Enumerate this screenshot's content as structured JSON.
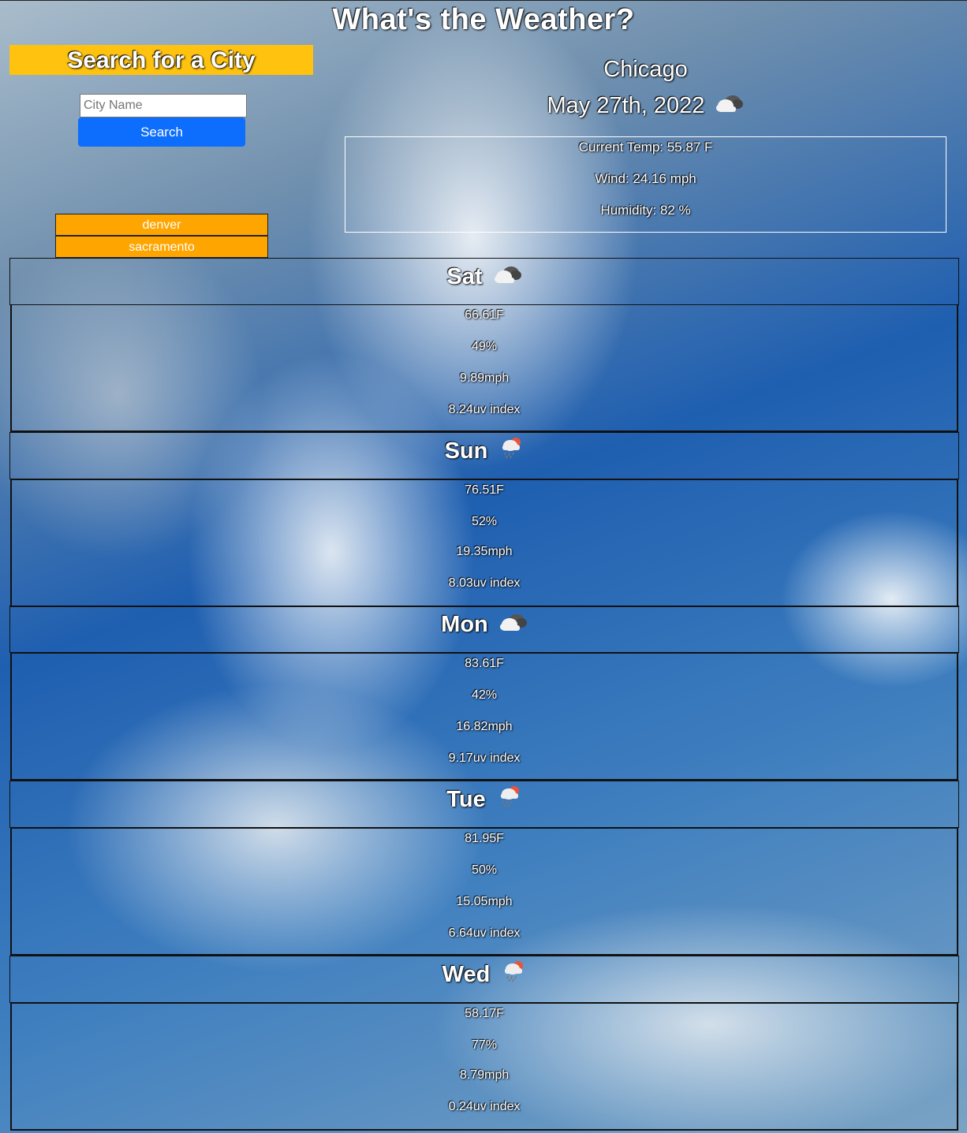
{
  "header": {
    "title": "What's the Weather?"
  },
  "search": {
    "heading": "Search for a City",
    "placeholder": "City Name",
    "button_label": "Search"
  },
  "history": [
    "denver",
    "sacramento"
  ],
  "current": {
    "city": "Chicago",
    "date": "May 27th, 2022",
    "icon": "cloud-icon",
    "temp": "Current Temp: 55.87 F",
    "wind": "Wind: 24.16 mph",
    "humidity": "Humidity: 82 %"
  },
  "forecast": [
    {
      "day": "Sat",
      "icon": "cloud-icon",
      "temp": "66.61F",
      "humidity": "49%",
      "wind": "9.89mph",
      "uv": "8.24uv index"
    },
    {
      "day": "Sun",
      "icon": "rain-icon",
      "temp": "76.51F",
      "humidity": "52%",
      "wind": "19.35mph",
      "uv": "8.03uv index"
    },
    {
      "day": "Mon",
      "icon": "cloud-icon",
      "temp": "83.61F",
      "humidity": "42%",
      "wind": "16.82mph",
      "uv": "9.17uv index"
    },
    {
      "day": "Tue",
      "icon": "rain-icon",
      "temp": "81.95F",
      "humidity": "50%",
      "wind": "15.05mph",
      "uv": "6.64uv index"
    },
    {
      "day": "Wed",
      "icon": "rain-icon",
      "temp": "58.17F",
      "humidity": "77%",
      "wind": "8.79mph",
      "uv": "0.24uv index"
    }
  ]
}
